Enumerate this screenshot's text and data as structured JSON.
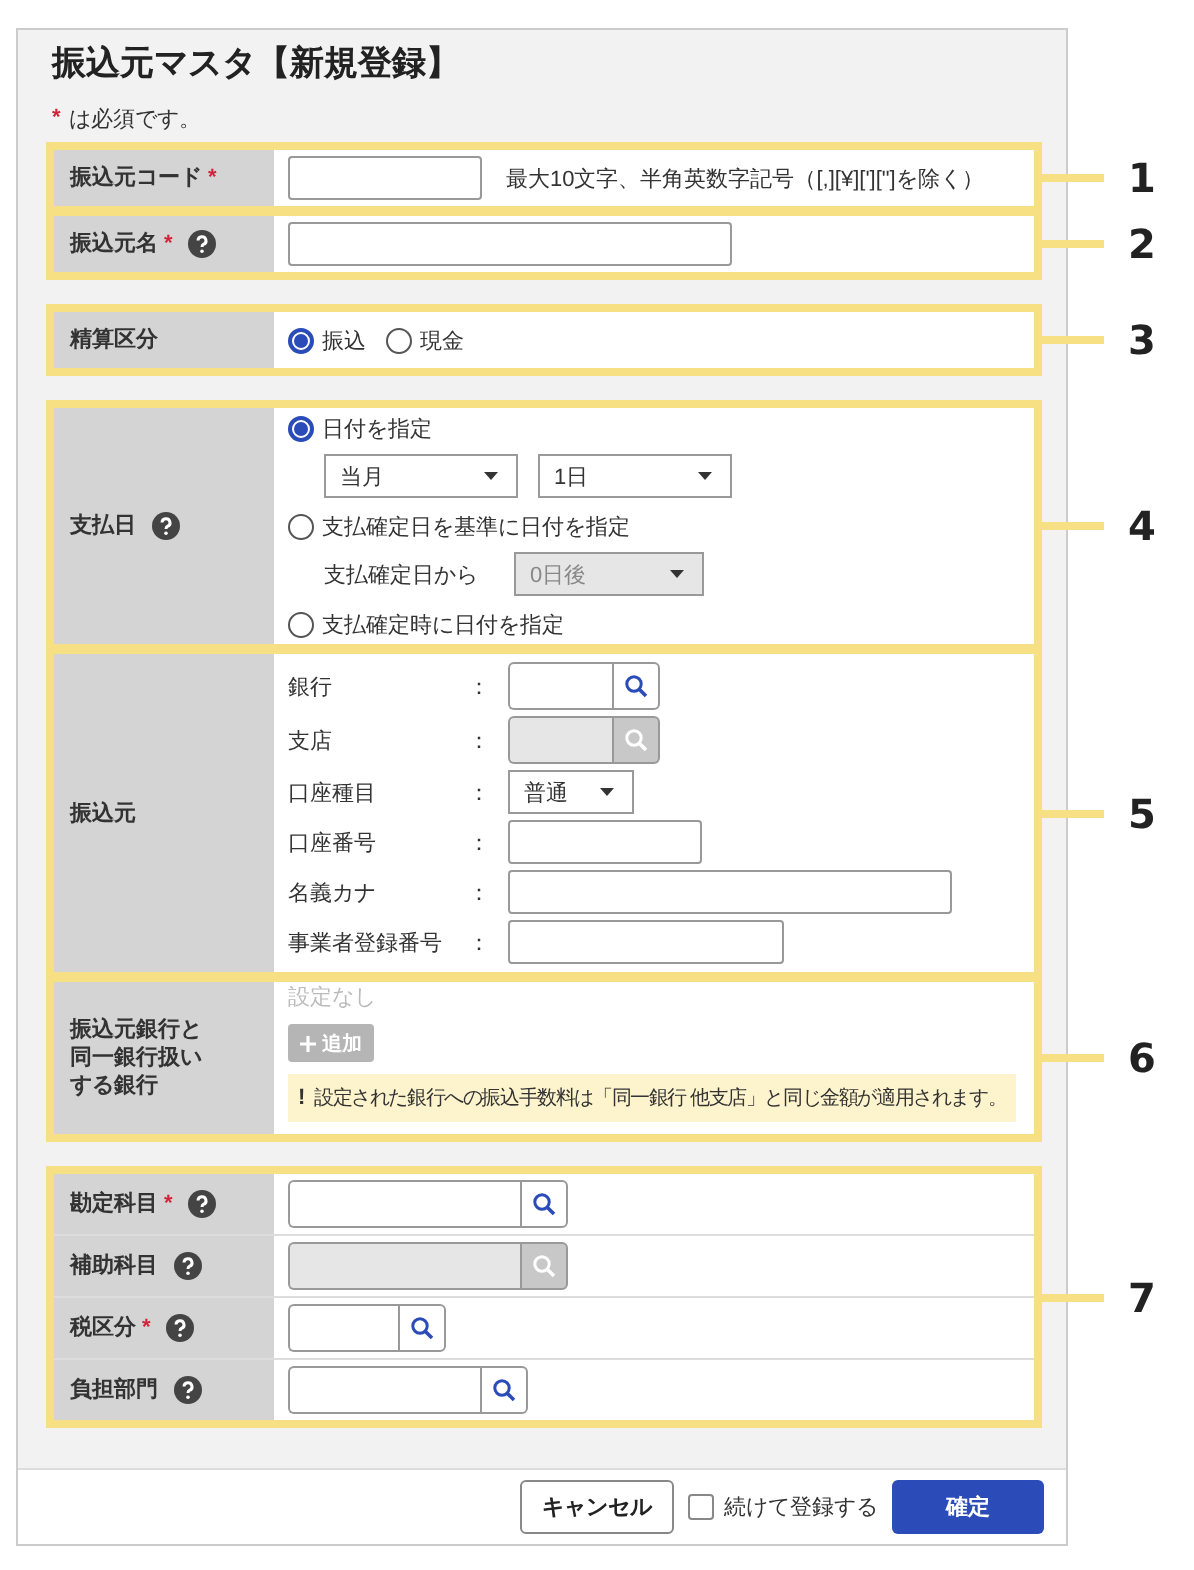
{
  "title": "振込元マスタ【新規登録】",
  "required_note": {
    "mark": "*",
    "text": "は必須です。"
  },
  "sections": [
    {
      "blocks": [
        {
          "callout": "1",
          "rows": [
            {
              "label": "振込元コード",
              "required_mark": "*",
              "help": false,
              "kind": "text",
              "hint": "最大10文字、半角英数字記号（[,][¥]['][\"]を除く）"
            }
          ]
        },
        {
          "callout": "2",
          "rows": [
            {
              "label": "振込元名",
              "required_mark": "*",
              "help": true,
              "kind": "text"
            }
          ]
        }
      ]
    },
    {
      "blocks": [
        {
          "callout": "3",
          "rows": [
            {
              "label": "精算区分",
              "help": false,
              "kind": "radios",
              "options": [
                {
                  "label": "振込",
                  "selected": true
                },
                {
                  "label": "現金",
                  "selected": false
                }
              ]
            }
          ]
        }
      ]
    },
    {
      "blocks": [
        {
          "callout": "4",
          "rows": [
            {
              "label": "支払日",
              "help": true,
              "kind": "date_options",
              "options": [
                {
                  "label": "日付を指定",
                  "selected": true,
                  "selects": [
                    {
                      "value": "当月",
                      "disabled": false
                    },
                    {
                      "value": "1日",
                      "disabled": false
                    }
                  ]
                },
                {
                  "label": "支払確定日を基準に日付を指定",
                  "selected": false,
                  "sub_label": "支払確定日から",
                  "selects": [
                    {
                      "value": "0日後",
                      "disabled": true
                    }
                  ]
                },
                {
                  "label": "支払確定時に日付を指定",
                  "selected": false
                }
              ]
            }
          ]
        },
        {
          "callout": "5",
          "rows": [
            {
              "label": "振込元",
              "help": false,
              "kind": "subfields",
              "fields": [
                {
                  "label": "銀行",
                  "separator": "：",
                  "kind": "lookup",
                  "disabled": false
                },
                {
                  "label": "支店",
                  "separator": "：",
                  "kind": "lookup",
                  "disabled": true
                },
                {
                  "label": "口座種目",
                  "separator": "：",
                  "kind": "select",
                  "value": "普通",
                  "disabled": false
                },
                {
                  "label": "口座番号",
                  "separator": "：",
                  "kind": "text",
                  "disabled": false
                },
                {
                  "label": "名義カナ",
                  "separator": "：",
                  "kind": "text",
                  "disabled": false
                },
                {
                  "label": "事業者登録番号",
                  "separator": "：",
                  "kind": "text",
                  "disabled": false
                }
              ]
            }
          ]
        },
        {
          "callout": "6",
          "rows": [
            {
              "label": "振込元銀行と同一銀行扱いする銀行",
              "help": false,
              "kind": "related_banks",
              "empty_text": "設定なし",
              "add_button": {
                "label": "追加",
                "disabled": true
              },
              "notice": {
                "mark": "!",
                "text": "設定された銀行への振込手数料は「同一銀行 他支店」と同じ金額が適用されます。"
              }
            }
          ]
        }
      ]
    },
    {
      "blocks": [
        {
          "callout": "7",
          "rows": [
            {
              "label": "勘定科目",
              "required_mark": "*",
              "help": true,
              "kind": "lookup",
              "disabled": false
            },
            {
              "label": "補助科目",
              "help": true,
              "kind": "lookup",
              "disabled": true
            },
            {
              "label": "税区分",
              "required_mark": "*",
              "help": true,
              "kind": "lookup",
              "disabled": false
            },
            {
              "label": "負担部門",
              "help": true,
              "kind": "lookup",
              "disabled": false
            }
          ]
        }
      ]
    }
  ],
  "footer": {
    "cancel": "キャンセル",
    "continue": {
      "label": "続けて登録する",
      "checked": false
    },
    "confirm": "確定"
  }
}
